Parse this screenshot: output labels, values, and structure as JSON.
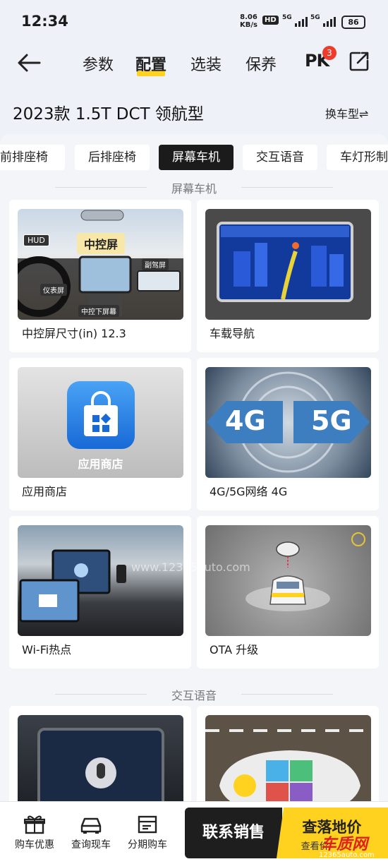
{
  "status": {
    "time": "12:34",
    "speed_value": "8.06",
    "speed_unit": "KB/s",
    "hd": "HD",
    "sig1": "5G",
    "sig2": "5G",
    "battery": "86"
  },
  "nav": {
    "tabs": [
      "参数",
      "配置",
      "选装",
      "保养"
    ],
    "active_tab": "配置",
    "pk_label": "PK",
    "pk_count": "3"
  },
  "model": {
    "name": "2023款 1.5T DCT 领航型",
    "switch_label": "换车型⇌"
  },
  "chips": [
    "前排座椅",
    "后排座椅",
    "屏幕车机",
    "交互语音",
    "车灯形制"
  ],
  "active_chip": "屏幕车机",
  "sections": [
    {
      "title": "屏幕车机",
      "cards": [
        {
          "caption": "中控屏尺寸(in) 12.3",
          "labels": [
            "HUD",
            "中控屏",
            "副驾屏",
            "仪表屏",
            "中控下屏幕"
          ]
        },
        {
          "caption": "车载导航"
        },
        {
          "caption": "应用商店",
          "labels": [
            "应用商店"
          ]
        },
        {
          "caption": "4G/5G网络 4G",
          "labels": [
            "4G",
            "5G"
          ]
        },
        {
          "caption": "Wi-Fi热点"
        },
        {
          "caption": "OTA 升级"
        }
      ]
    },
    {
      "title": "交互语音"
    }
  ],
  "watermark_mid": "www.12365auto.com",
  "bottom": {
    "items": [
      "购车优惠",
      "查询现车",
      "分期购车"
    ],
    "contact": "联系销售",
    "price_title": "查落地价",
    "price_sub": "查看价",
    "brand": "车质网",
    "brand_url": "12365auto.com"
  }
}
